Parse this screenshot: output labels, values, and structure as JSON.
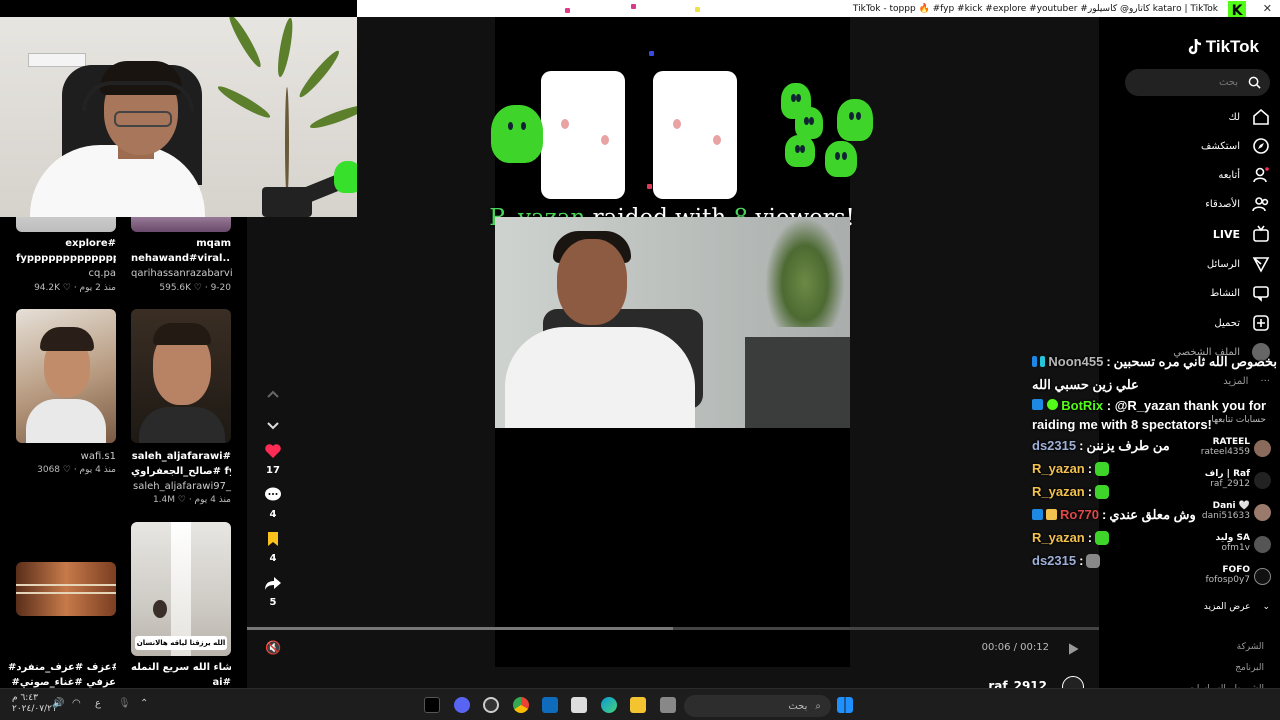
{
  "window": {
    "title": "TikTok - toppp 🔥 #fyp #kick #explore #youtuber #كاتارو@ كاسيلور katarо | TikTok"
  },
  "brand": {
    "name": "TikTok"
  },
  "search": {
    "placeholder": "بحث"
  },
  "nav": {
    "items": [
      {
        "label": "لك",
        "icon": "home-icon"
      },
      {
        "label": "استكشف",
        "icon": "compass-icon"
      },
      {
        "label": "أتابعه",
        "icon": "following-icon"
      },
      {
        "label": "الأصدقاء",
        "icon": "friends-icon"
      },
      {
        "label": "LIVE",
        "icon": "live-icon"
      },
      {
        "label": "الرسائل",
        "icon": "messages-icon"
      },
      {
        "label": "النشاط",
        "icon": "activity-icon"
      },
      {
        "label": "تحميل",
        "icon": "upload-icon"
      }
    ],
    "profile_label": "الملف الشخصي",
    "more_label": "المزيد",
    "following_heading": "حسابات تتابعها",
    "following": [
      {
        "name": "RATEEL",
        "handle": "rateel4359"
      },
      {
        "name": "راف | Raf",
        "handle": "raf_2912"
      },
      {
        "name": "Dani 🤍",
        "handle": "dani51633"
      },
      {
        "name": "وليد SA",
        "handle": "ofm1v"
      },
      {
        "name": "FOFO",
        "handle": "fofosp0y7"
      }
    ],
    "see_more": "عرض المزيد",
    "footer": [
      "الشركة",
      "البرنامج",
      "الشروط والسياسات"
    ]
  },
  "feed": {
    "items": [
      {
        "caption": "explore#",
        "title": "fypppppppppppppp...",
        "user": "cq.pa",
        "likes": "94.2K",
        "age": "منذ 2 يوم"
      },
      {
        "caption": "mqam",
        "title": "nehawand#viral...",
        "user": "qarihassanrazabarvi",
        "likes": "595.6K",
        "age": "9-20"
      },
      {
        "caption": "",
        "title": "",
        "user": "wafi.s1",
        "likes": "3068",
        "age": "منذ 4 يوم"
      },
      {
        "caption": "saleh_aljafarawi#",
        "title": "صالح_الجعفراوي# fyp#...",
        "user": "saleh_aljafarawi97_",
        "likes": "1.4M",
        "age": "منذ 4 يوم"
      },
      {
        "caption": "#غناء #عزف #عزف_منفرد",
        "title": "#عزفي #غناء_صوتي",
        "user": "",
        "likes": "",
        "age": ""
      },
      {
        "caption": "ماشاء الله سريع النمله 😂😂",
        "title": "ai#",
        "user": "",
        "likes": "",
        "age": ""
      }
    ],
    "overlay_text": "الله يرزقنا لياقه هالانسان :"
  },
  "stream": {
    "raid_user": "R_yazan",
    "raid_mid": " raided with ",
    "raid_count": "8",
    "raid_end": " viewers!"
  },
  "player": {
    "likes": "17",
    "comments": "4",
    "saves": "4",
    "shares": "5",
    "time": "00:06 / 00:12",
    "author_peek": "raf_2912",
    "progress": 0.5
  },
  "chat": {
    "messages": [
      {
        "user": "Noon455",
        "user_color": "#b7b7b7",
        "text": "بخصوص الله ثاني مره تسحبين",
        "extra": "علي زين حسبي الله",
        "badges": 2
      },
      {
        "user": "BotRix",
        "user_color": "#53fc18",
        "text": "@R_yazan thank you for raiding me with 8 spectators!",
        "badges": 2
      },
      {
        "user": "ds2315",
        "user_color": "#9fb0d8",
        "text": "من طرف يزننن",
        "badges": 0
      },
      {
        "user": "R_yazan",
        "user_color": "#f2c14e",
        "text": "",
        "emote": true,
        "badges": 0
      },
      {
        "user": "R_yazan",
        "user_color": "#f2c14e",
        "text": "",
        "emote": true,
        "badges": 0
      },
      {
        "user": "Ro770",
        "user_color": "#e04848",
        "text": "وش معلق عندي",
        "badges": 2
      },
      {
        "user": "R_yazan",
        "user_color": "#f2c14e",
        "text": "",
        "emote": true,
        "badges": 0
      },
      {
        "user": "ds2315",
        "user_color": "#9fb0d8",
        "text": "",
        "emote": true,
        "badges": 0
      }
    ]
  },
  "taskbar": {
    "search": "بحث",
    "time": "٦:٤٣ م",
    "date": "٢٠٢٤/٠٧/٢١",
    "lang": "ع"
  },
  "colors": {
    "accent": "#fe2c55",
    "kick_green": "#53fc18"
  }
}
